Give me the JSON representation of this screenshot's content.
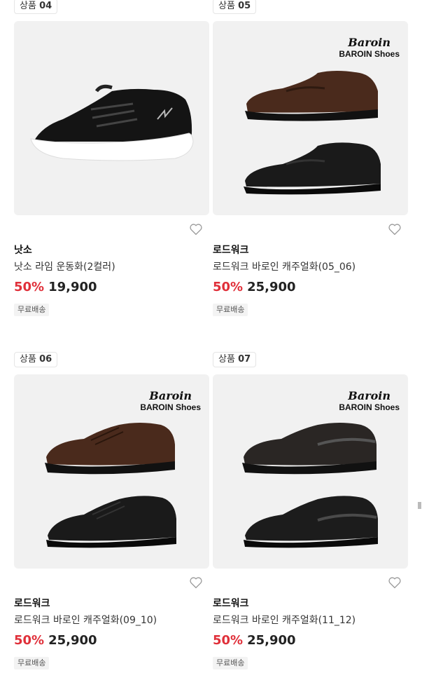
{
  "products": [
    {
      "badge_label": "상품",
      "badge_no": "04",
      "brand": "낫소",
      "name": "낫소 라임 운동화(2컬러)",
      "discount": "50%",
      "price": "19,900",
      "shipping": "무료배송",
      "logo": null
    },
    {
      "badge_label": "상품",
      "badge_no": "05",
      "brand": "로드워크",
      "name": "로드워크 바로인 캐주얼화(05_06)",
      "discount": "50%",
      "price": "25,900",
      "shipping": "무료배송",
      "logo": {
        "script": "Baroin",
        "text": "BAROIN Shoes"
      }
    },
    {
      "badge_label": "상품",
      "badge_no": "06",
      "brand": "로드워크",
      "name": "로드워크 바로인 캐주얼화(09_10)",
      "discount": "50%",
      "price": "25,900",
      "shipping": "무료배송",
      "logo": {
        "script": "Baroin",
        "text": "BAROIN Shoes"
      }
    },
    {
      "badge_label": "상품",
      "badge_no": "07",
      "brand": "로드워크",
      "name": "로드워크 바로인 캐주얼화(11_12)",
      "discount": "50%",
      "price": "25,900",
      "shipping": "무료배송",
      "logo": {
        "script": "Baroin",
        "text": "BAROIN Shoes"
      }
    }
  ],
  "colors": {
    "discount": "#e0303a",
    "image_bg": "#f1f1f1",
    "brown_shoe": "#4a2a1c",
    "black_shoe": "#1a1a1a"
  }
}
